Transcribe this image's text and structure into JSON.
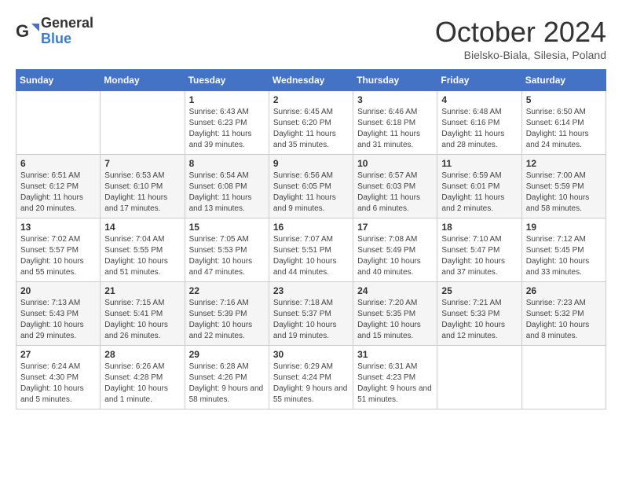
{
  "logo": {
    "general": "General",
    "blue": "Blue"
  },
  "title": "October 2024",
  "subtitle": "Bielsko-Biala, Silesia, Poland",
  "days_of_week": [
    "Sunday",
    "Monday",
    "Tuesday",
    "Wednesday",
    "Thursday",
    "Friday",
    "Saturday"
  ],
  "weeks": [
    [
      {
        "day": "",
        "info": ""
      },
      {
        "day": "",
        "info": ""
      },
      {
        "day": "1",
        "info": "Sunrise: 6:43 AM\nSunset: 6:23 PM\nDaylight: 11 hours and 39 minutes."
      },
      {
        "day": "2",
        "info": "Sunrise: 6:45 AM\nSunset: 6:20 PM\nDaylight: 11 hours and 35 minutes."
      },
      {
        "day": "3",
        "info": "Sunrise: 6:46 AM\nSunset: 6:18 PM\nDaylight: 11 hours and 31 minutes."
      },
      {
        "day": "4",
        "info": "Sunrise: 6:48 AM\nSunset: 6:16 PM\nDaylight: 11 hours and 28 minutes."
      },
      {
        "day": "5",
        "info": "Sunrise: 6:50 AM\nSunset: 6:14 PM\nDaylight: 11 hours and 24 minutes."
      }
    ],
    [
      {
        "day": "6",
        "info": "Sunrise: 6:51 AM\nSunset: 6:12 PM\nDaylight: 11 hours and 20 minutes."
      },
      {
        "day": "7",
        "info": "Sunrise: 6:53 AM\nSunset: 6:10 PM\nDaylight: 11 hours and 17 minutes."
      },
      {
        "day": "8",
        "info": "Sunrise: 6:54 AM\nSunset: 6:08 PM\nDaylight: 11 hours and 13 minutes."
      },
      {
        "day": "9",
        "info": "Sunrise: 6:56 AM\nSunset: 6:05 PM\nDaylight: 11 hours and 9 minutes."
      },
      {
        "day": "10",
        "info": "Sunrise: 6:57 AM\nSunset: 6:03 PM\nDaylight: 11 hours and 6 minutes."
      },
      {
        "day": "11",
        "info": "Sunrise: 6:59 AM\nSunset: 6:01 PM\nDaylight: 11 hours and 2 minutes."
      },
      {
        "day": "12",
        "info": "Sunrise: 7:00 AM\nSunset: 5:59 PM\nDaylight: 10 hours and 58 minutes."
      }
    ],
    [
      {
        "day": "13",
        "info": "Sunrise: 7:02 AM\nSunset: 5:57 PM\nDaylight: 10 hours and 55 minutes."
      },
      {
        "day": "14",
        "info": "Sunrise: 7:04 AM\nSunset: 5:55 PM\nDaylight: 10 hours and 51 minutes."
      },
      {
        "day": "15",
        "info": "Sunrise: 7:05 AM\nSunset: 5:53 PM\nDaylight: 10 hours and 47 minutes."
      },
      {
        "day": "16",
        "info": "Sunrise: 7:07 AM\nSunset: 5:51 PM\nDaylight: 10 hours and 44 minutes."
      },
      {
        "day": "17",
        "info": "Sunrise: 7:08 AM\nSunset: 5:49 PM\nDaylight: 10 hours and 40 minutes."
      },
      {
        "day": "18",
        "info": "Sunrise: 7:10 AM\nSunset: 5:47 PM\nDaylight: 10 hours and 37 minutes."
      },
      {
        "day": "19",
        "info": "Sunrise: 7:12 AM\nSunset: 5:45 PM\nDaylight: 10 hours and 33 minutes."
      }
    ],
    [
      {
        "day": "20",
        "info": "Sunrise: 7:13 AM\nSunset: 5:43 PM\nDaylight: 10 hours and 29 minutes."
      },
      {
        "day": "21",
        "info": "Sunrise: 7:15 AM\nSunset: 5:41 PM\nDaylight: 10 hours and 26 minutes."
      },
      {
        "day": "22",
        "info": "Sunrise: 7:16 AM\nSunset: 5:39 PM\nDaylight: 10 hours and 22 minutes."
      },
      {
        "day": "23",
        "info": "Sunrise: 7:18 AM\nSunset: 5:37 PM\nDaylight: 10 hours and 19 minutes."
      },
      {
        "day": "24",
        "info": "Sunrise: 7:20 AM\nSunset: 5:35 PM\nDaylight: 10 hours and 15 minutes."
      },
      {
        "day": "25",
        "info": "Sunrise: 7:21 AM\nSunset: 5:33 PM\nDaylight: 10 hours and 12 minutes."
      },
      {
        "day": "26",
        "info": "Sunrise: 7:23 AM\nSunset: 5:32 PM\nDaylight: 10 hours and 8 minutes."
      }
    ],
    [
      {
        "day": "27",
        "info": "Sunrise: 6:24 AM\nSunset: 4:30 PM\nDaylight: 10 hours and 5 minutes."
      },
      {
        "day": "28",
        "info": "Sunrise: 6:26 AM\nSunset: 4:28 PM\nDaylight: 10 hours and 1 minute."
      },
      {
        "day": "29",
        "info": "Sunrise: 6:28 AM\nSunset: 4:26 PM\nDaylight: 9 hours and 58 minutes."
      },
      {
        "day": "30",
        "info": "Sunrise: 6:29 AM\nSunset: 4:24 PM\nDaylight: 9 hours and 55 minutes."
      },
      {
        "day": "31",
        "info": "Sunrise: 6:31 AM\nSunset: 4:23 PM\nDaylight: 9 hours and 51 minutes."
      },
      {
        "day": "",
        "info": ""
      },
      {
        "day": "",
        "info": ""
      }
    ]
  ]
}
